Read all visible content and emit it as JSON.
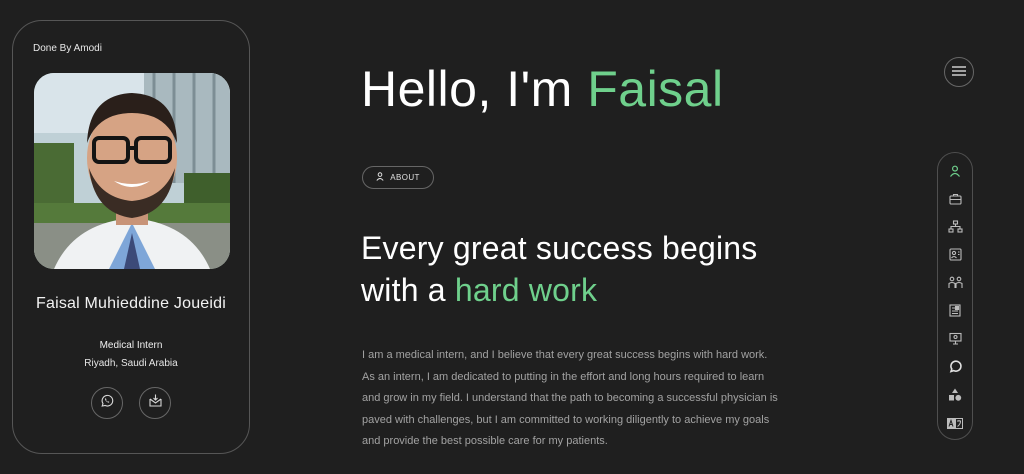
{
  "card": {
    "credit": "Done By Amodi",
    "name": "Faisal Muhieddine Joueidi",
    "role": "Medical Intern",
    "location": "Riyadh, Saudi Arabia",
    "social": [
      {
        "icon": "whatsapp-icon"
      },
      {
        "icon": "mail-icon"
      }
    ]
  },
  "hero": {
    "greeting": "Hello, I'm",
    "name": "Faisal",
    "about_label": "ABOUT",
    "headline_line1": "Every great success begins",
    "headline_line2_prefix": "with a",
    "headline_accent": "hard work",
    "bio": "I am a medical intern, and I believe that every great success begins with hard work. As an intern, I am dedicated to putting in the effort and long hours required to learn and grow in my field. I understand that the path to becoming a successful physician is paved with challenges, but I am committed to working diligently to achieve my goals and provide the best possible care for my patients."
  },
  "nav": {
    "menu_icon": "hamburger-icon",
    "items": [
      {
        "icon": "user-icon",
        "active": true
      },
      {
        "icon": "briefcase-icon",
        "active": false
      },
      {
        "icon": "sitemap-icon",
        "active": false
      },
      {
        "icon": "contact-card-icon",
        "active": false
      },
      {
        "icon": "people-icon",
        "active": false
      },
      {
        "icon": "document-icon",
        "active": false
      },
      {
        "icon": "presentation-icon",
        "active": false
      },
      {
        "icon": "chat-bubble-icon",
        "active": false
      },
      {
        "icon": "shapes-icon",
        "active": false
      },
      {
        "icon": "translate-icon",
        "active": false
      }
    ]
  },
  "colors": {
    "accent": "#6fd08c",
    "background": "#1f1f1f"
  }
}
